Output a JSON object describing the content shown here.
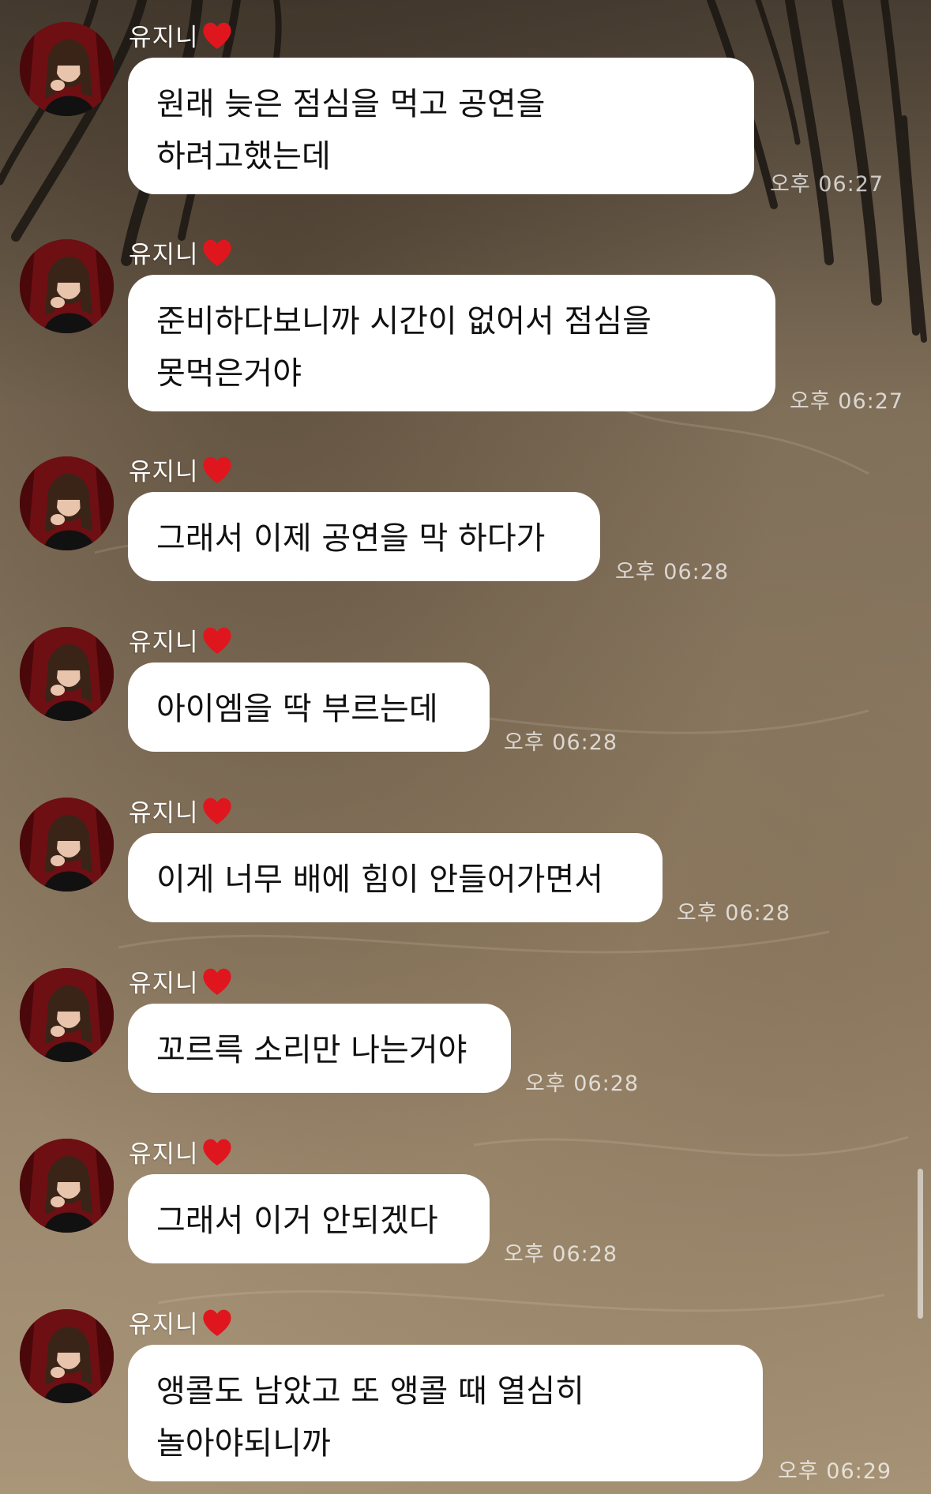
{
  "messages": [
    {
      "sender": "유지니",
      "text": "원래 늦은 점심을 먹고 공연을 하려고했는데",
      "time": "오후 06:27"
    },
    {
      "sender": "유지니",
      "text": "준비하다보니까 시간이 없어서 점심을 못먹은거야",
      "time": "오후 06:27"
    },
    {
      "sender": "유지니",
      "text": "그래서 이제 공연을 막 하다가",
      "time": "오후 06:28"
    },
    {
      "sender": "유지니",
      "text": "아이엠을 딱 부르는데",
      "time": "오후 06:28"
    },
    {
      "sender": "유지니",
      "text": "이게 너무 배에 힘이 안들어가면서",
      "time": "오후 06:28"
    },
    {
      "sender": "유지니",
      "text": "꼬르륵 소리만 나는거야",
      "time": "오후 06:28"
    },
    {
      "sender": "유지니",
      "text": "그래서 이거 안되겠다",
      "time": "오후 06:28"
    },
    {
      "sender": "유지니",
      "text": "앵콜도 남았고 또 앵콜 때 열심히 놀아야되니까",
      "time": "오후 06:29"
    }
  ],
  "icons": {
    "sender_badge": "heart-icon",
    "avatar": "profile-photo"
  },
  "colors": {
    "bubble": "#ffffff",
    "heart": "#e0161e",
    "timestamp": "#ffffffb8"
  }
}
